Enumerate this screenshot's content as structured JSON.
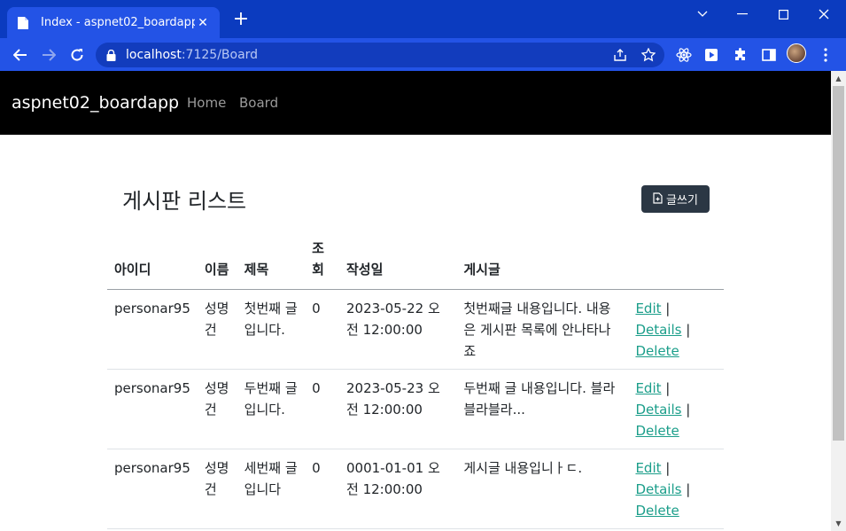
{
  "browser": {
    "tab_title": "Index - aspnet02_boardapp",
    "url_host": "localhost",
    "url_path": ":7125/Board"
  },
  "site": {
    "brand": "aspnet02_boardapp",
    "nav": [
      "Home",
      "Board"
    ]
  },
  "page": {
    "title": "게시판 리스트",
    "write_button": "글쓰기"
  },
  "table": {
    "headers": [
      "아이디",
      "이름",
      "제목",
      "조회",
      "작성일",
      "게시글"
    ],
    "rows": [
      {
        "id": "personar95",
        "name": "성명건",
        "title": "첫번째 글입니다.",
        "views": "0",
        "date": "2023-05-22 오전 12:00:00",
        "content": "첫번째글 내용입니다. 내용은 게시판 목록에 안나타나죠"
      },
      {
        "id": "personar95",
        "name": "성명건",
        "title": "두번째 글입니다.",
        "views": "0",
        "date": "2023-05-23 오전 12:00:00",
        "content": "두번째 글 내용입니다. 블라블라블라..."
      },
      {
        "id": "personar95",
        "name": "성명건",
        "title": "세번째 글입니다",
        "views": "0",
        "date": "0001-01-01 오전 12:00:00",
        "content": "게시글 내용입니ㅏㄷ."
      }
    ],
    "actions": {
      "edit": "Edit",
      "details": "Details",
      "delete": "Delete",
      "separator": "|"
    }
  },
  "colors": {
    "browser_frame": "#0b3bbf",
    "browser_toolbar": "#2353e6",
    "site_nav": "#000000",
    "write_button": "#2b3744",
    "link": "#1b9e8a"
  },
  "icons": {
    "tab": "page-icon",
    "write": "file-plus-icon"
  }
}
